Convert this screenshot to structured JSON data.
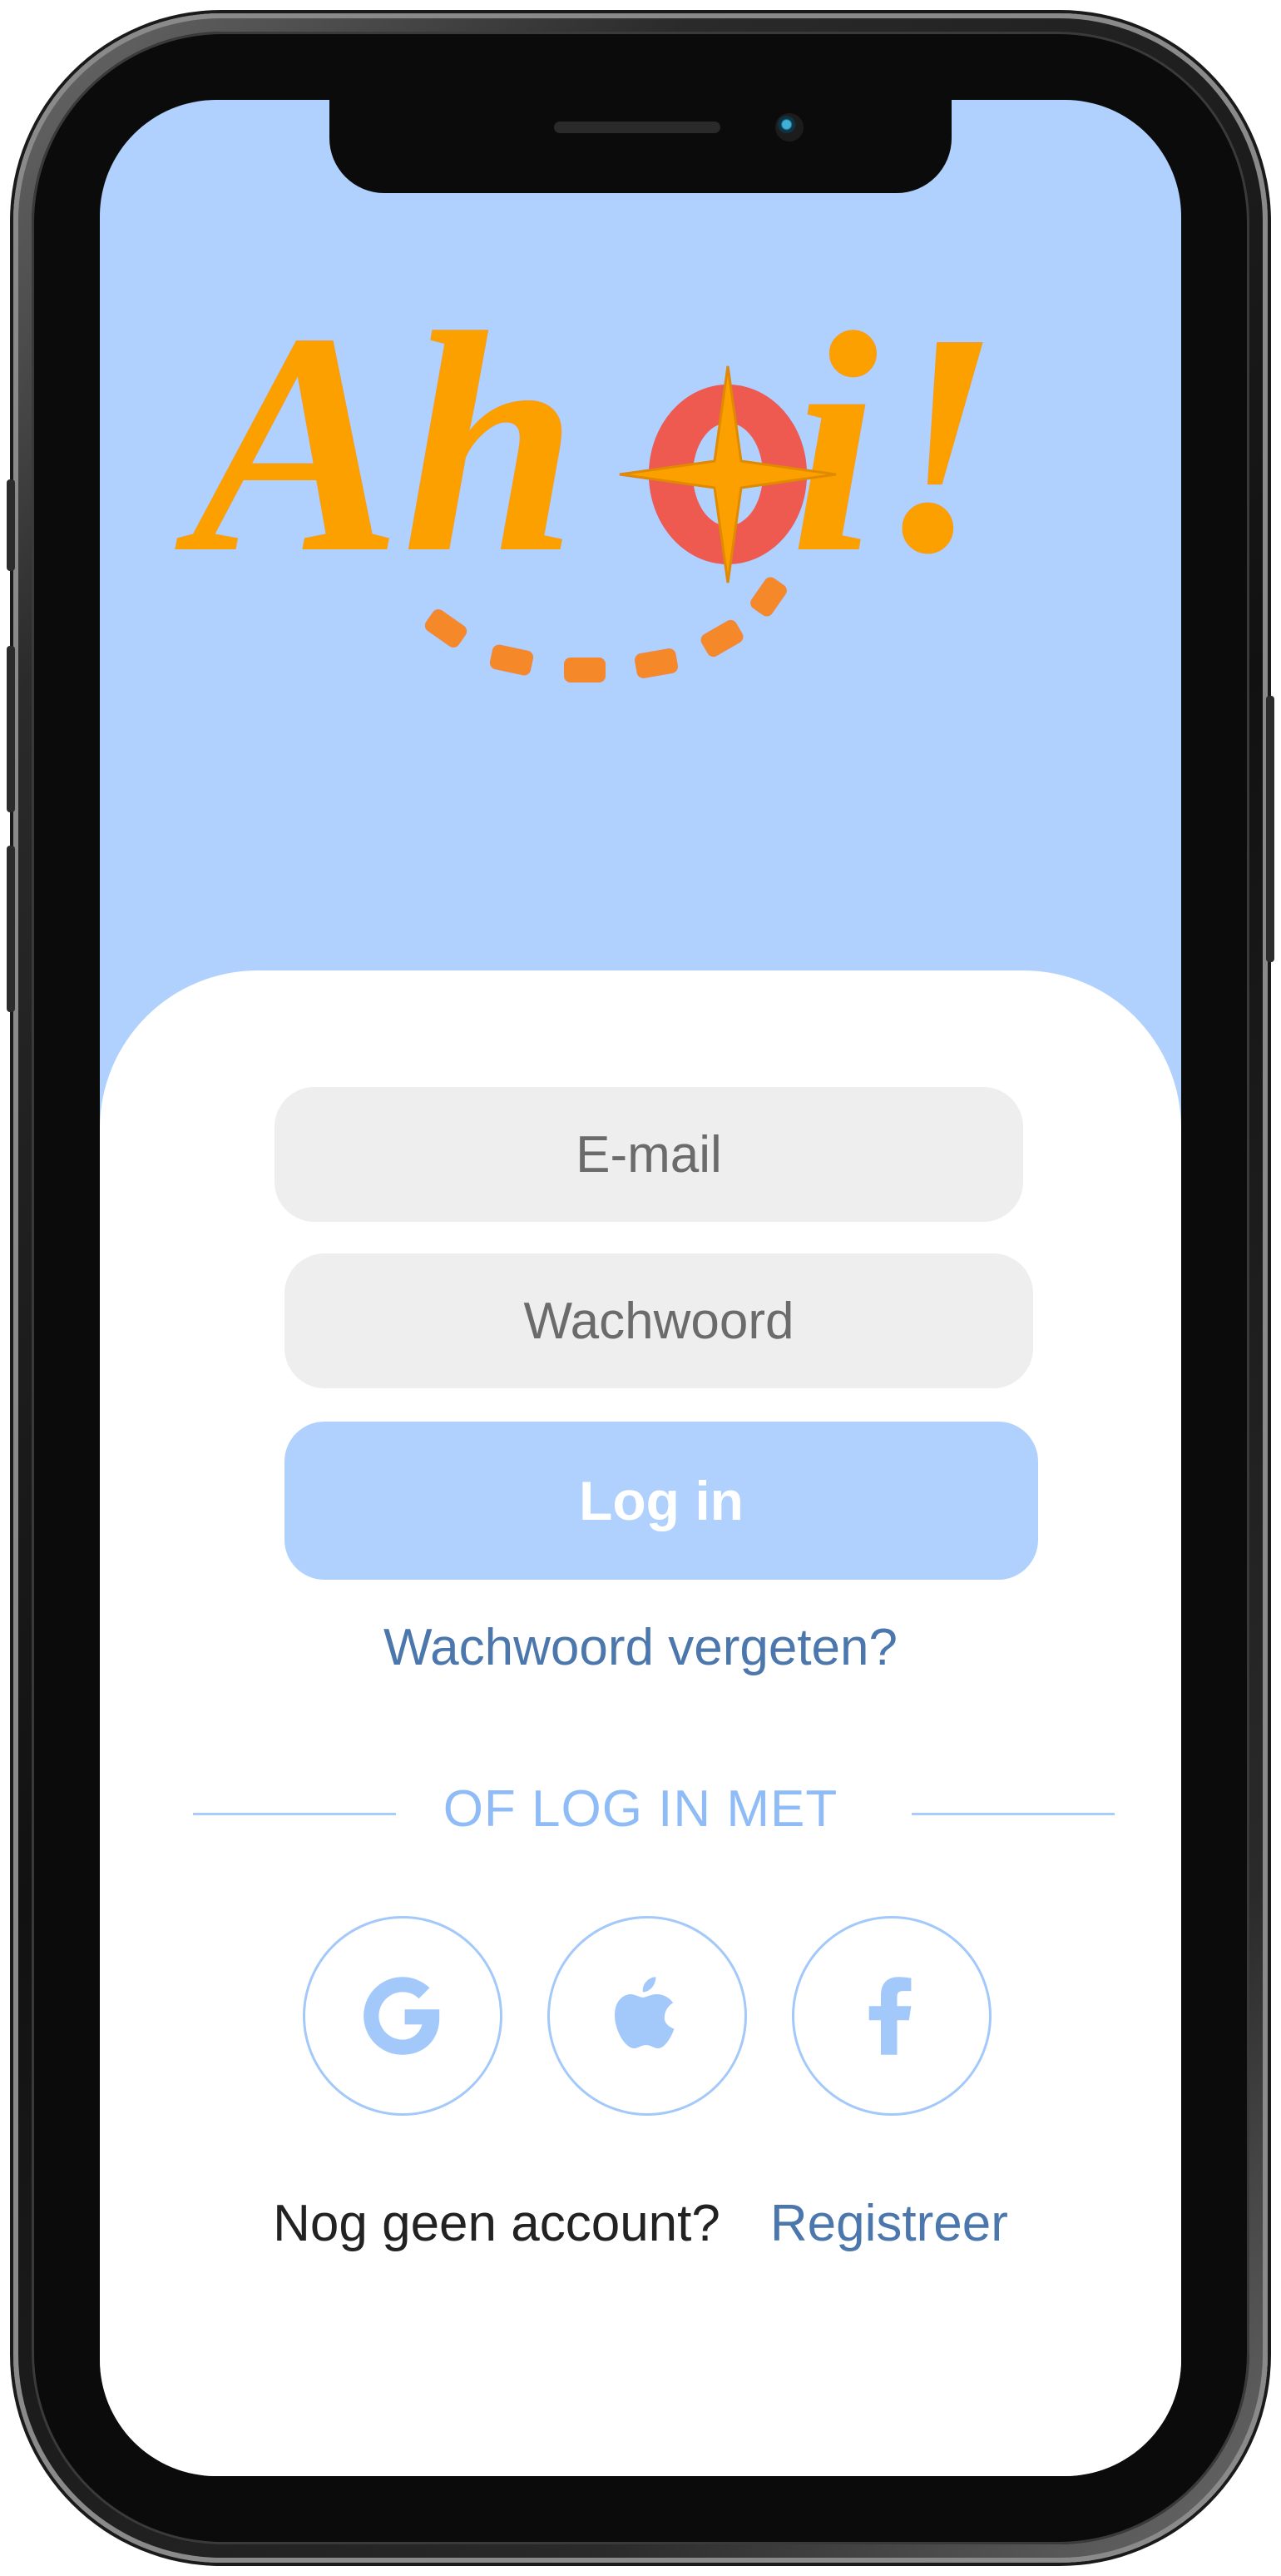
{
  "app": {
    "logo_text": "Ahoi!",
    "colors": {
      "background": "#b0d1fd",
      "logo_orange": "#fca000",
      "logo_red": "#ee5a4f",
      "accent_blue": "#4b77ad",
      "light_blue": "#8fbcf7",
      "field_bg": "#eeeeee"
    }
  },
  "form": {
    "email_placeholder": "E-mail",
    "password_placeholder": "Wachwoord",
    "login_label": "Log in",
    "forgot_link": "Wachwoord vergeten?"
  },
  "social": {
    "divider_label": "OF LOG IN MET",
    "providers": [
      {
        "name": "google",
        "icon": "google-icon"
      },
      {
        "name": "apple",
        "icon": "apple-icon"
      },
      {
        "name": "facebook",
        "icon": "facebook-icon"
      }
    ]
  },
  "footer": {
    "no_account": "Nog geen account?",
    "register_link": "Registreer"
  }
}
